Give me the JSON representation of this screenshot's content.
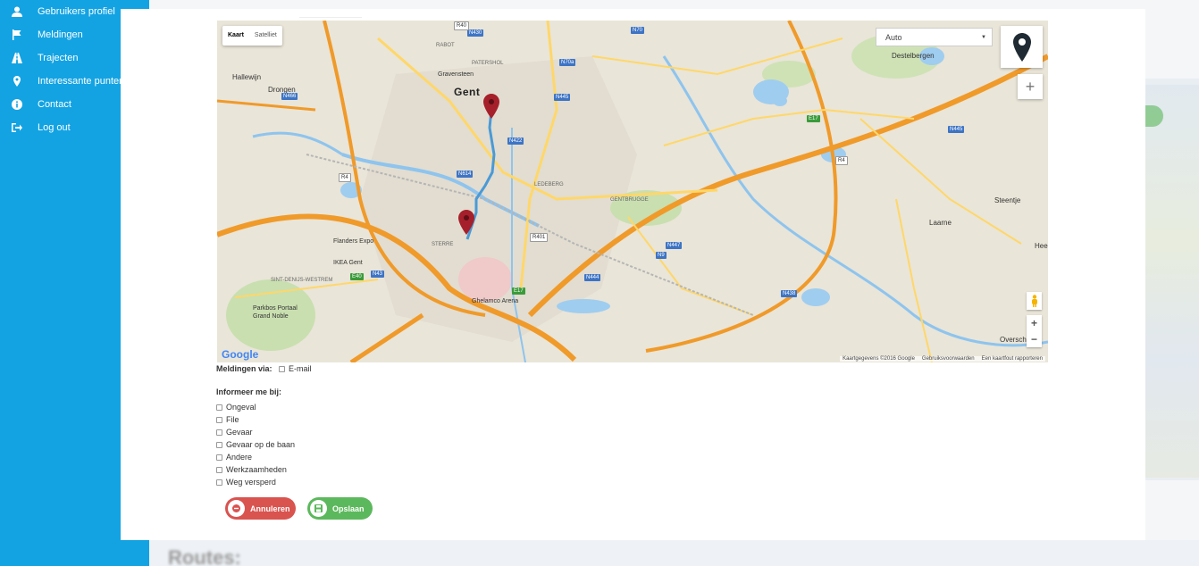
{
  "sidebar": {
    "items": [
      {
        "label": "Gebruikers profiel",
        "icon": "user-icon"
      },
      {
        "label": "Meldingen",
        "icon": "flag-icon"
      },
      {
        "label": "Trajecten",
        "icon": "road-icon"
      },
      {
        "label": "Interessante punten",
        "icon": "map-marker-icon"
      },
      {
        "label": "Contact",
        "icon": "info-icon"
      },
      {
        "label": "Log out",
        "icon": "sign-out-icon"
      }
    ]
  },
  "map": {
    "type_tabs": [
      "Kaart",
      "Satelliet"
    ],
    "active_tab": "Kaart",
    "travel_mode": "Auto",
    "google_logo": "Google",
    "attribution": [
      "Kaartgegevens ©2016 Google",
      "Gebruiksvoorwaarden",
      "Een kaartfout rapporteren"
    ],
    "labels": {
      "gent": "Gent",
      "destelbergen": "Destelbergen",
      "drongen": "Drongen",
      "hallewijn": "Hallewijn",
      "gravensteen": "Gravensteen",
      "patershol": "PATERSHOL",
      "rabot": "RABOT",
      "ledeberg": "LEDEBERG",
      "gentbrugge": "GENTBRUGGE",
      "flanders_expo": "Flanders Expo",
      "ikea": "IKEA Gent",
      "sterre": "STERRE",
      "sint_denijs": "SINT-DENIJS-WESTREM",
      "parkbos": "Parkbos Portaal Grand Noble",
      "ghelamco": "Ghelamco Arena",
      "laarne": "Laarne",
      "steentje": "Steentje",
      "overschelde": "Oversch",
      "hee": "Hee"
    },
    "road_shields": [
      "N430",
      "N70",
      "R40",
      "N70a",
      "N445",
      "N466",
      "N422",
      "N614",
      "R4",
      "E17",
      "E40",
      "N43",
      "R401",
      "N9",
      "N447",
      "N444",
      "N438",
      "N445",
      "E17",
      "R4"
    ]
  },
  "form": {
    "notify_via_label": "Meldingen via:",
    "email_label": "E-mail",
    "inform_label": "Informeer me bij:",
    "options": [
      "Ongeval",
      "File",
      "Gevaar",
      "Gevaar op de baan",
      "Andere",
      "Werkzaamheden",
      "Weg versperd"
    ]
  },
  "buttons": {
    "cancel": "Annuleren",
    "save": "Opslaan"
  },
  "background": {
    "routes_heading": "Routes:"
  },
  "colors": {
    "sidebar": "#13a3e3",
    "cancel": "#d9534f",
    "save": "#5cb85c",
    "marker": "#a5202a",
    "route": "#4a9ad6"
  }
}
